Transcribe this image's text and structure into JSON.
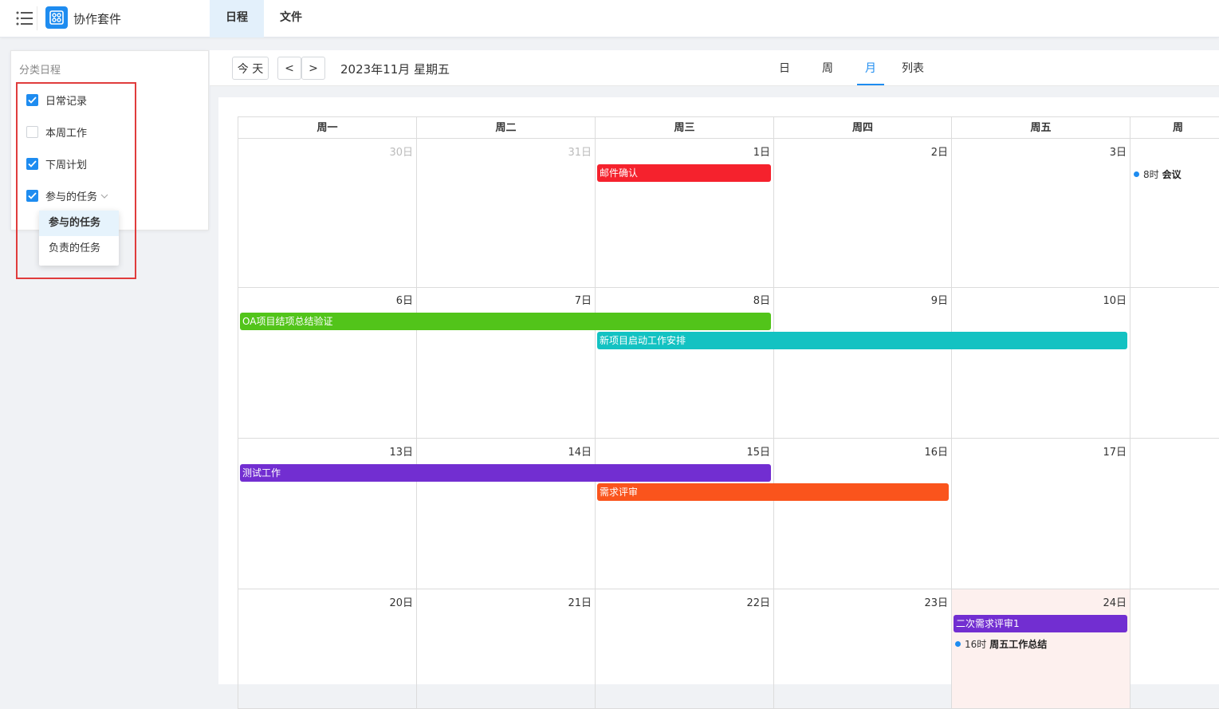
{
  "header": {
    "app_title": "协作套件",
    "tabs": [
      {
        "label": "日程",
        "active": true
      },
      {
        "label": "文件",
        "active": false
      }
    ]
  },
  "sidebar": {
    "title": "分类日程",
    "categories": [
      {
        "label": "日常记录",
        "checked": true
      },
      {
        "label": "本周工作",
        "checked": false
      },
      {
        "label": "下周计划",
        "checked": true
      },
      {
        "label": "参与的任务",
        "checked": true
      }
    ],
    "dropdown": [
      {
        "label": "参与的任务",
        "active": true
      },
      {
        "label": "负责的任务",
        "active": false
      }
    ]
  },
  "toolbar": {
    "today_label": "今 天",
    "prev_label": "<",
    "next_label": ">",
    "current_date": "2023年11月 星期五",
    "views": [
      {
        "label": "日",
        "active": false
      },
      {
        "label": "周",
        "active": false
      },
      {
        "label": "月",
        "active": true
      },
      {
        "label": "列表",
        "active": false
      }
    ]
  },
  "calendar": {
    "weekdays": [
      "周一",
      "周二",
      "周三",
      "周四",
      "周五",
      "周"
    ],
    "weeks": [
      [
        "30日",
        "31日",
        "1日",
        "2日",
        "3日",
        ""
      ],
      [
        "6日",
        "7日",
        "8日",
        "9日",
        "10日",
        ""
      ],
      [
        "13日",
        "14日",
        "15日",
        "16日",
        "17日",
        ""
      ],
      [
        "20日",
        "21日",
        "22日",
        "23日",
        "24日",
        ""
      ]
    ],
    "muted_days": [
      [
        0,
        0
      ],
      [
        0,
        1
      ]
    ],
    "today": [
      3,
      4
    ],
    "bar_events": [
      {
        "title": "邮件确认",
        "color": "#f5222d",
        "week": 0,
        "start": 2,
        "end": 2,
        "lane": 0
      },
      {
        "title": "OA项目结项总结验证",
        "color": "#52c41a",
        "week": 1,
        "start": 0,
        "end": 2,
        "lane": 0
      },
      {
        "title": "新项目启动工作安排",
        "color": "#13c2c2",
        "week": 1,
        "start": 2,
        "end": 4,
        "lane": 1
      },
      {
        "title": "测试工作",
        "color": "#722ed1",
        "week": 2,
        "start": 0,
        "end": 2,
        "lane": 0
      },
      {
        "title": "需求评审",
        "color": "#fa541c",
        "week": 2,
        "start": 2,
        "end": 3,
        "lane": 1
      },
      {
        "title": "二次需求评审1",
        "color": "#722ed1",
        "week": 3,
        "start": 4,
        "end": 4,
        "lane": 0
      }
    ],
    "dot_events": [
      {
        "time": "8时",
        "title": "会议",
        "week": 0,
        "day": 5,
        "lane": 0
      },
      {
        "time": "16时",
        "title": "周五工作总结",
        "week": 3,
        "day": 4,
        "lane": 1
      }
    ]
  }
}
